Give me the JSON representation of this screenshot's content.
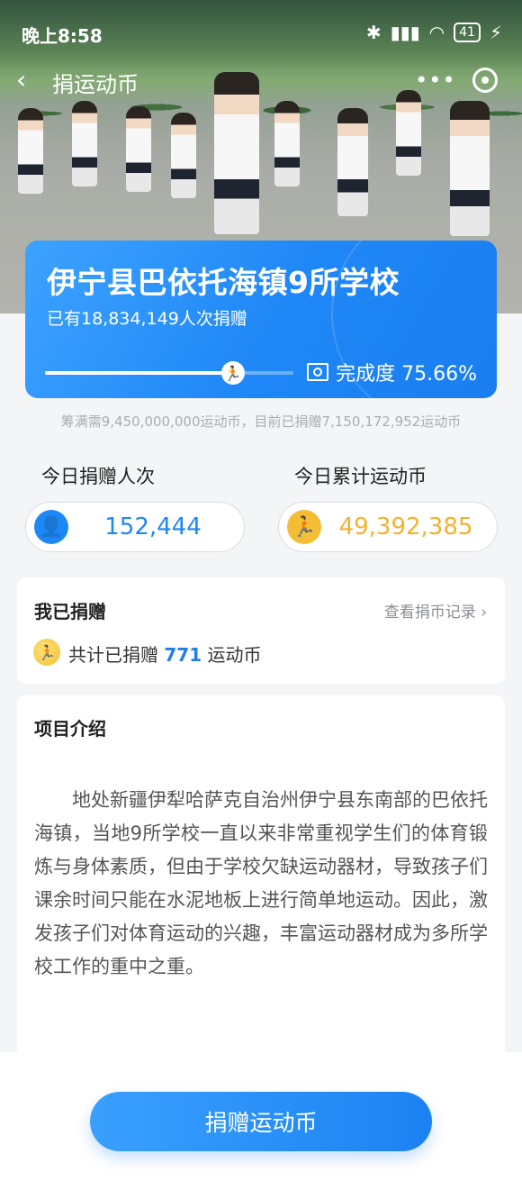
{
  "status_bar": {
    "time": "晚上8:58",
    "battery": "41"
  },
  "nav": {
    "title": "捐运动币",
    "back_glyph": "‹",
    "more_glyph": "•••"
  },
  "project": {
    "school_name": "伊宁县巴依托海镇9所学校",
    "donor_count": "已有18,834,149人次捐赠",
    "completion_label": "完成度 75.66%",
    "progress": 0.7566
  },
  "target_line": "筹满需9,450,000,000运动币，目前已捐赠7,150,172,952运动币",
  "stats": {
    "today_donors_label": "今日捐赠人次",
    "today_donors_value": "152,444",
    "today_coins_label": "今日累计运动币",
    "today_coins_value": "49,392,385"
  },
  "my_donation": {
    "title": "我已捐赠",
    "record_link": "查看捐币记录 ›",
    "prefix": "共计已捐赠",
    "amount": "771",
    "suffix": "运动币"
  },
  "intro": {
    "title": "项目介绍",
    "body": "地处新疆伊犁哈萨克自治州伊宁县东南部的巴依托海镇，当地9所学校一直以来非常重视学生们的体育锻炼与身体素质，但由于学校欠缺运动器材，导致孩子们课余时间只能在水泥地板上进行简单地运动。因此，激发孩子们对体育运动的兴趣，丰富运动器材成为多所学校工作的重中之重。"
  },
  "donate_button": "捐赠运动币",
  "colors": {
    "accent": "#1e87f6",
    "coin": "#f3be33",
    "muted": "#a9adb3"
  }
}
